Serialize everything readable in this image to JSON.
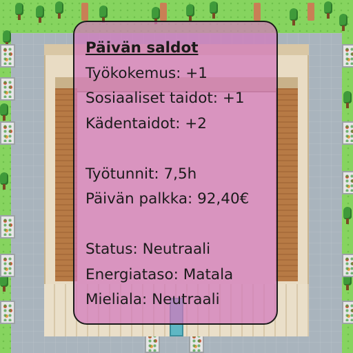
{
  "summary": {
    "title": "Päivän saldot",
    "lines": [
      "Työkokemus: +1",
      "Sosiaaliset taidot: +1",
      "Kädentaidot: +2",
      "",
      "Työtunnit: 7,5h",
      "Päivän palkka: 92,40€",
      "",
      "Status: Neutraali",
      "Energiataso: Matala",
      "Mieliala: Neutraali"
    ]
  },
  "colors": {
    "overlay": "#d378bd",
    "grass": "#86d45f",
    "pavement": "#a9b4bd"
  }
}
